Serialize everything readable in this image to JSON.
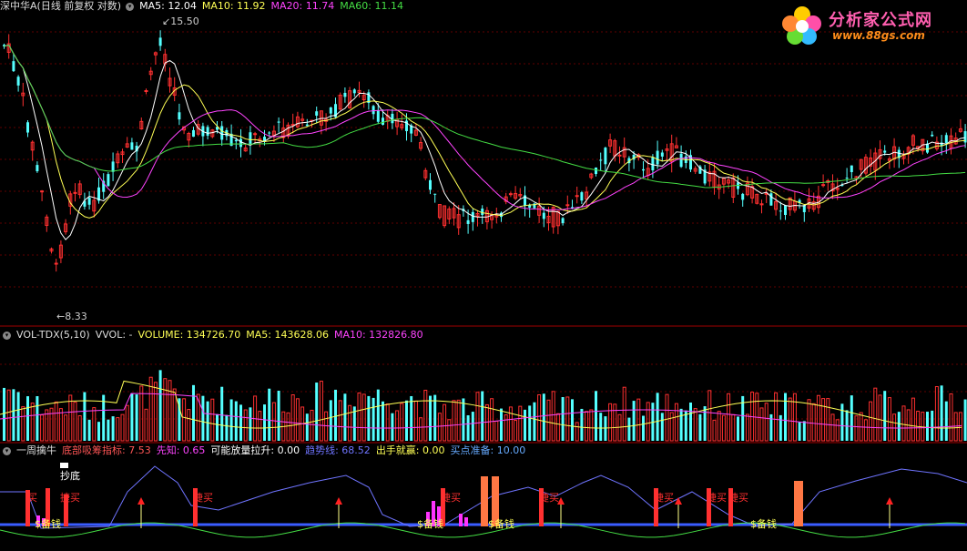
{
  "main_header": {
    "title": "深中华A(日线 前复权 对数)",
    "ma5": "MA5: 12.04",
    "ma10": "MA10: 11.92",
    "ma20": "MA20: 11.74",
    "ma60": "MA60: 11.14"
  },
  "price_marks": {
    "high": "15.50",
    "low": "8.33"
  },
  "vol_header": {
    "title": "VOL-TDX(5,10)",
    "vvol": "VVOL: -",
    "volume": "VOLUME: 134726.70",
    "ma5": "MA5: 143628.06",
    "ma10": "MA10: 132826.80"
  },
  "ind_header": {
    "title": "一周擒牛",
    "dibu": "底部吸筹指标: 7.53",
    "xianzhi": "先知: 0.65",
    "kenengfang": "可能放量拉升: 0.00",
    "qushixian": "趋势线: 68.52",
    "chushou": "出手就赢: 0.00",
    "maidian": "买点准备: 10.00"
  },
  "ind_labels": {
    "chaodi": "抄底",
    "buy": "买",
    "jiebuy": "捷买",
    "beiqian": "$备钱"
  },
  "logo": {
    "name": "分析家公式网",
    "url": "www.88gs.com"
  },
  "colors": {
    "up": "#ff3030",
    "down": "#54ffff",
    "ma5": "#ffffff",
    "ma10": "#ffff55",
    "ma20": "#ff44ff",
    "ma60": "#44dd44",
    "trend": "#6f74ff"
  }
}
